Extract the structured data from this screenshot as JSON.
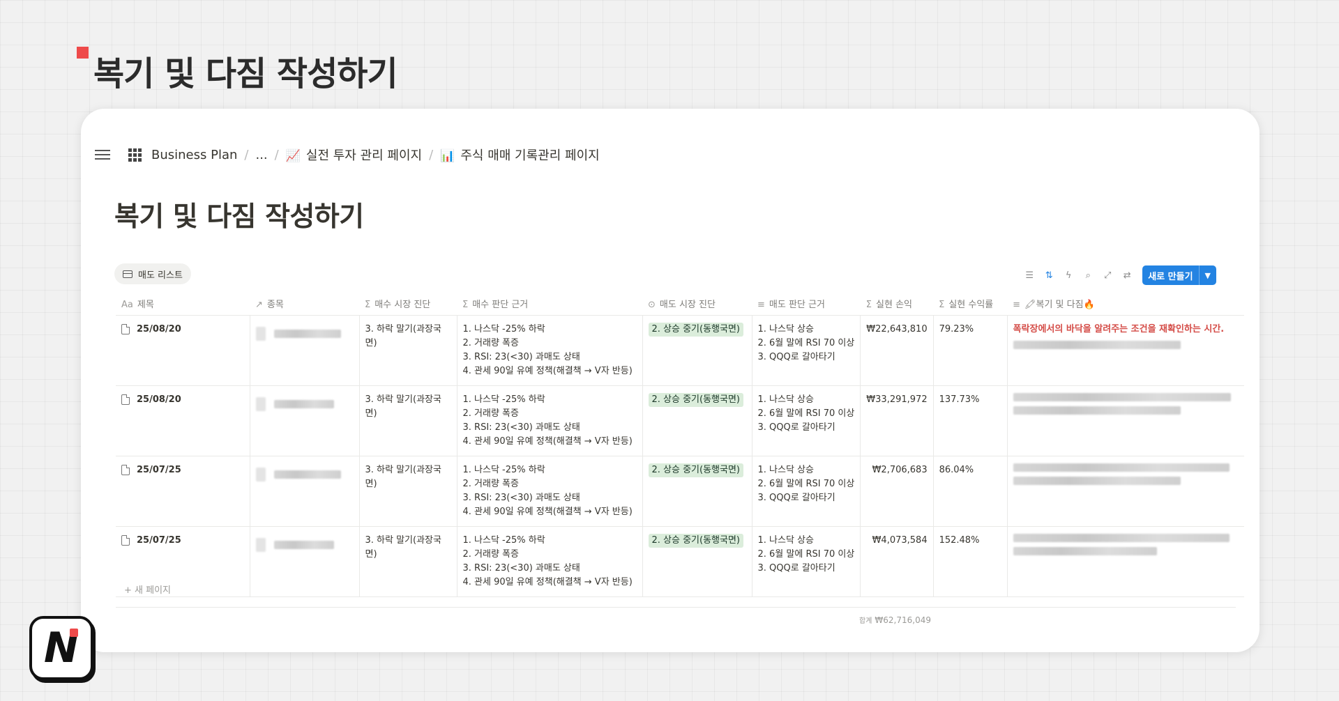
{
  "slide": {
    "title": "복기 및 다짐 작성하기",
    "accent": "#ee4a4a"
  },
  "breadcrumb": {
    "workspace": "Business Plan",
    "ellipsis": "...",
    "page1_emoji": "📈",
    "page1": "실전 투자 관리 페이지",
    "page2_emoji": "📊",
    "page2": "주식 매매 기록관리 페이지"
  },
  "page": {
    "title": "복기 및 다짐 작성하기"
  },
  "view": {
    "tab_label": "매도 리스트"
  },
  "toolbar": {
    "new_label": "새로 만들기",
    "new_color": "#2383e2"
  },
  "columns": {
    "title": "제목",
    "ticker": "종목",
    "buy_diag": "매수 시장 진단",
    "buy_reason": "매수 판단 근거",
    "sell_diag": "매도 시장 진단",
    "sell_reason": "매도 판단 근거",
    "pnl": "실현 손익",
    "ret": "실현 수익률",
    "reflect": "🖍복기 및 다짐🔥"
  },
  "rows": [
    {
      "date": "25/08/20",
      "buy_diag": "3. 하락 말기(과장국면)",
      "buy_reason": [
        "1. 나스닥 -25% 하락",
        "2. 거래량 폭증",
        "3. RSI: 23(<30) 과매도 상태",
        "4. 관세 90일 유예 정책(해결책 → V자 반등)"
      ],
      "sell_diag": "2. 상승 중기(동행국면)",
      "sell_reason": [
        "1. 나스닥 상승",
        "2. 6월 말에 RSI 70 이상",
        "3. QQQ로 갈아타기"
      ],
      "pnl": "₩22,643,810",
      "ret": "79.23%",
      "reflect": "폭락장에서의 바닥을 알려주는 조건을 재확인하는 시간."
    },
    {
      "date": "25/08/20",
      "buy_diag": "3. 하락 말기(과장국면)",
      "buy_reason": [
        "1. 나스닥 -25% 하락",
        "2. 거래량 폭증",
        "3. RSI: 23(<30) 과매도 상태",
        "4. 관세 90일 유예 정책(해결책 → V자 반등)"
      ],
      "sell_diag": "2. 상승 중기(동행국면)",
      "sell_reason": [
        "1. 나스닥 상승",
        "2. 6월 말에 RSI 70 이상",
        "3. QQQ로 갈아타기"
      ],
      "pnl": "₩33,291,972",
      "ret": "137.73%",
      "reflect": ""
    },
    {
      "date": "25/07/25",
      "buy_diag": "3. 하락 말기(과장국면)",
      "buy_reason": [
        "1. 나스닥 -25% 하락",
        "2. 거래량 폭증",
        "3. RSI: 23(<30) 과매도 상태",
        "4. 관세 90일 유예 정책(해결책 → V자 반등)"
      ],
      "sell_diag": "2. 상승 중기(동행국면)",
      "sell_reason": [
        "1. 나스닥 상승",
        "2. 6월 말에 RSI 70 이상",
        "3. QQQ로 갈아타기"
      ],
      "pnl": "₩2,706,683",
      "ret": "86.04%",
      "reflect": ""
    },
    {
      "date": "25/07/25",
      "buy_diag": "3. 하락 말기(과장국면)",
      "buy_reason": [
        "1. 나스닥 -25% 하락",
        "2. 거래량 폭증",
        "3. RSI: 23(<30) 과매도 상태",
        "4. 관세 90일 유예 정책(해결책 → V자 반등)"
      ],
      "sell_diag": "2. 상승 중기(동행국면)",
      "sell_reason": [
        "1. 나스닥 상승",
        "2. 6월 말에 RSI 70 이상",
        "3. QQQ로 갈아타기"
      ],
      "pnl": "₩4,073,584",
      "ret": "152.48%",
      "reflect": ""
    }
  ],
  "footer": {
    "new_page": "+ 새 페이지",
    "sum_label": "합계",
    "sum_value": "₩62,716,049"
  },
  "logo": {
    "letter": "N"
  },
  "colors": {
    "tag_bg": "#dbeddb",
    "reflect_red": "#d44c47"
  }
}
